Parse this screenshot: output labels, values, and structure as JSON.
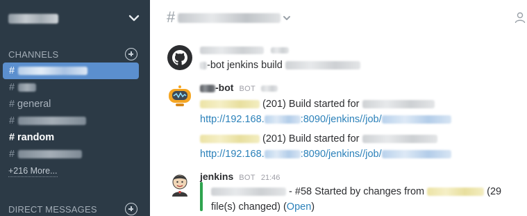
{
  "sidebar": {
    "sections": {
      "channels": "CHANNELS",
      "direct_messages": "DIRECT MESSAGES"
    },
    "channels": [
      {
        "hash": "#",
        "label": "",
        "state": "active"
      },
      {
        "hash": "#",
        "label": "",
        "state": "normal"
      },
      {
        "hash": "#",
        "label": "general",
        "state": "normal"
      },
      {
        "hash": "#",
        "label": "",
        "state": "normal"
      },
      {
        "hash": "#",
        "label": "random",
        "state": "unread"
      },
      {
        "hash": "#",
        "label": "",
        "state": "normal"
      }
    ],
    "more_label": "+216 More...",
    "colors": {
      "background": "#2c3a46",
      "active": "#5b8fce"
    }
  },
  "header": {
    "hash": "#"
  },
  "messages": [
    {
      "avatar": "github-icon",
      "lines": {
        "l1_suffix": "-bot jenkins build"
      }
    },
    {
      "avatar": "robot-icon",
      "username_suffix": "-bot",
      "badge": "BOT",
      "lines": {
        "l1": "(201) Build started for",
        "l2_a": "http://192.168.",
        "l2_b": ":8090/jenkins//job/",
        "l3": "(201) Build started for",
        "l4_a": "http://192.168.",
        "l4_b": ":8090/jenkins//job/"
      }
    },
    {
      "avatar": "jenkins-icon",
      "username": "jenkins",
      "badge": "BOT",
      "time": "21:46",
      "lines": {
        "l1_mid": "- #58 Started by changes from",
        "l1_end": "(29",
        "l2_a": "file(s) changed) (",
        "l2_link": "Open",
        "l2_b": ")"
      },
      "attachment_color": "#2fa44f"
    }
  ]
}
